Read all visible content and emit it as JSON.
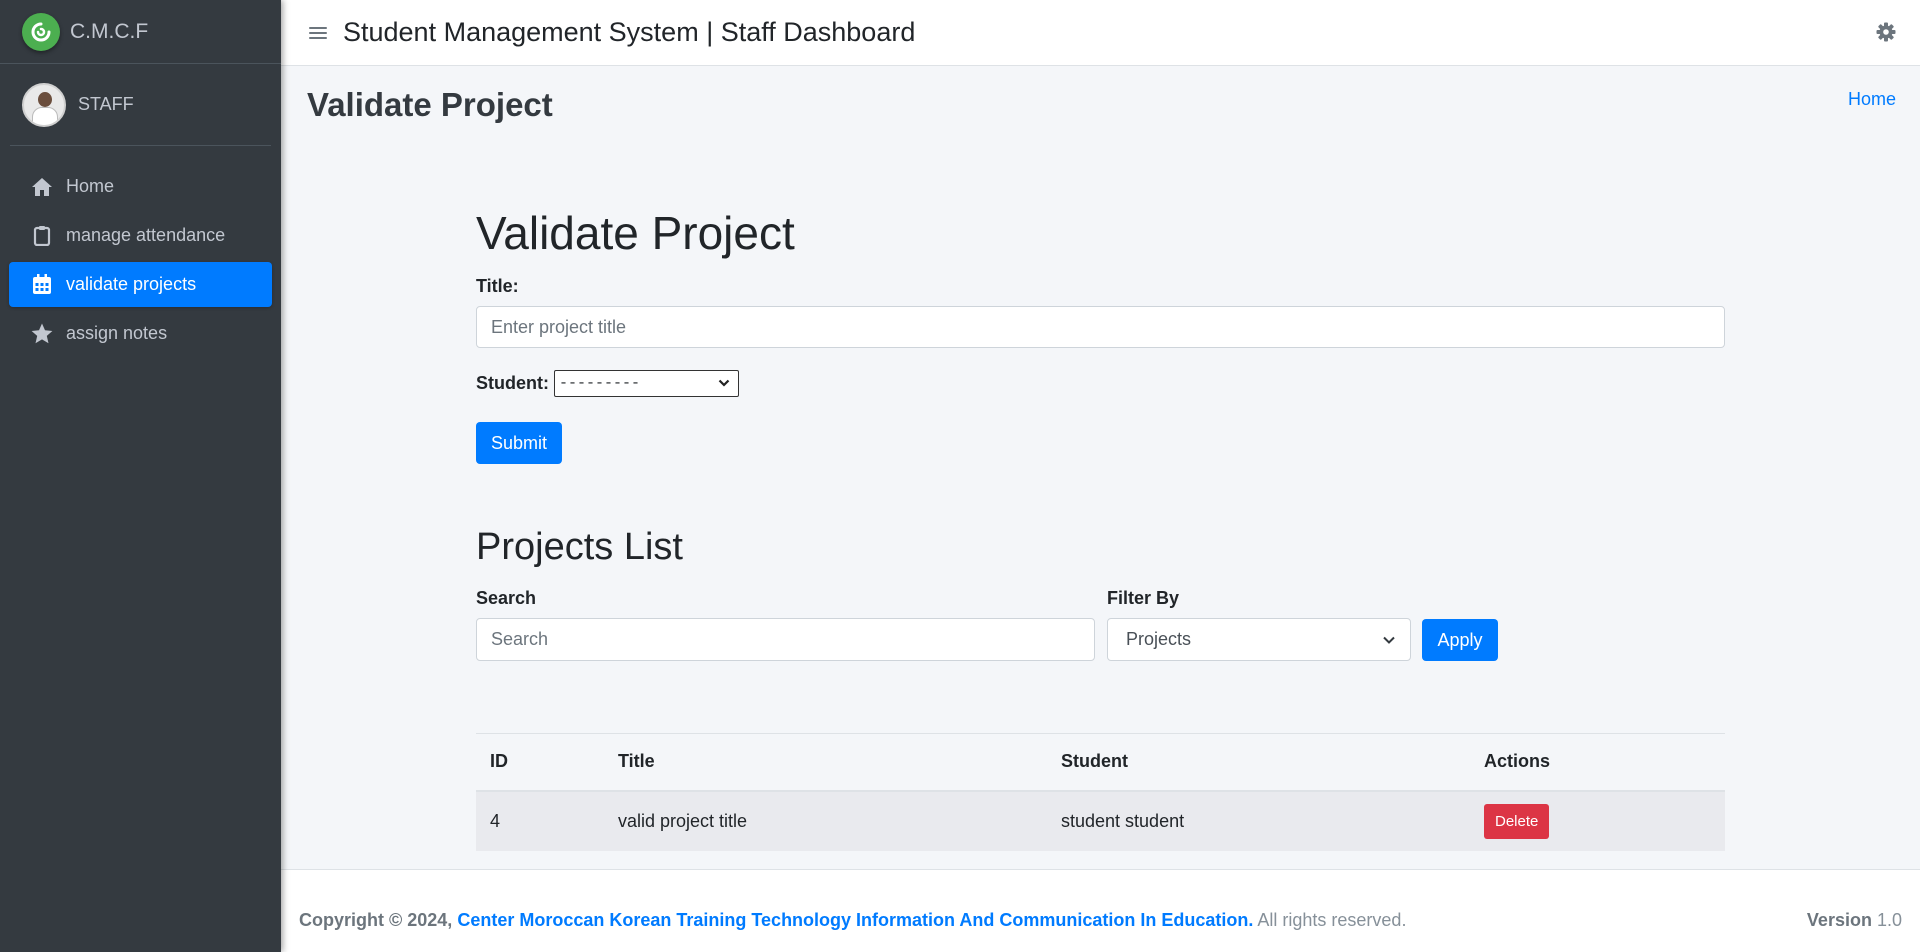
{
  "brand": {
    "name": "C.M.C.F"
  },
  "user": {
    "name": "STAFF"
  },
  "sidebar": {
    "items": [
      {
        "label": "Home",
        "icon": "home-icon"
      },
      {
        "label": "manage attendance",
        "icon": "clipboard-icon"
      },
      {
        "label": "validate projects",
        "icon": "calendar-icon",
        "active": true
      },
      {
        "label": "assign notes",
        "icon": "star-icon"
      }
    ]
  },
  "header": {
    "title": "Student Management System | Staff Dashboard"
  },
  "content_header": {
    "title": "Validate Project",
    "breadcrumb": "Home"
  },
  "form": {
    "heading": "Validate Project",
    "title_label": "Title:",
    "title_placeholder": "Enter project title",
    "title_value": "",
    "student_label": "Student:",
    "student_selected": "---------",
    "submit_label": "Submit"
  },
  "list": {
    "heading": "Projects List",
    "search_label": "Search",
    "search_placeholder": "Search",
    "filter_label": "Filter By",
    "filter_selected": "Projects",
    "apply_label": "Apply"
  },
  "table": {
    "columns": [
      "ID",
      "Title",
      "Student",
      "Actions"
    ],
    "rows": [
      {
        "id": "4",
        "title": "valid project title",
        "student": "student student",
        "action": "Delete"
      }
    ]
  },
  "footer": {
    "copyright_prefix": "Copyright © 2024,",
    "org": "Center Moroccan Korean Training Technology Information And Communication In Education.",
    "rights": "All rights reserved.",
    "version_label": "Version",
    "version_value": "1.0"
  },
  "colors": {
    "primary": "#007bff",
    "sidebar": "#343a40",
    "danger": "#dc3545",
    "logo": "#4caf50"
  }
}
